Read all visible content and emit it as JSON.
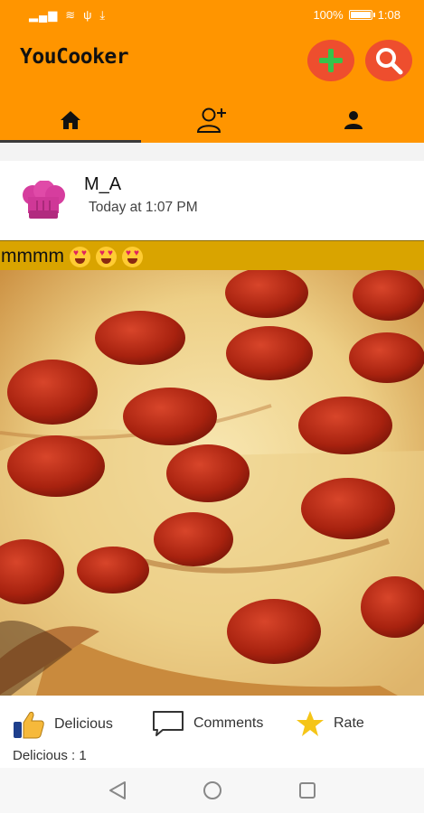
{
  "status_bar": {
    "battery": "100%",
    "time": "1:08"
  },
  "app": {
    "title": "YouCooker"
  },
  "post": {
    "user_name": "M_A",
    "time": "Today  at 1:07 PM",
    "caption": "mmmm"
  },
  "actions": {
    "like_label": "Delicious",
    "comment_label": "Comments",
    "rate_label": "Rate",
    "likes_count": "Delicious : 1"
  },
  "colors": {
    "appbar": "#ff9500",
    "round_button": "#ee4e2e",
    "caption_bar": "#d9a400"
  }
}
